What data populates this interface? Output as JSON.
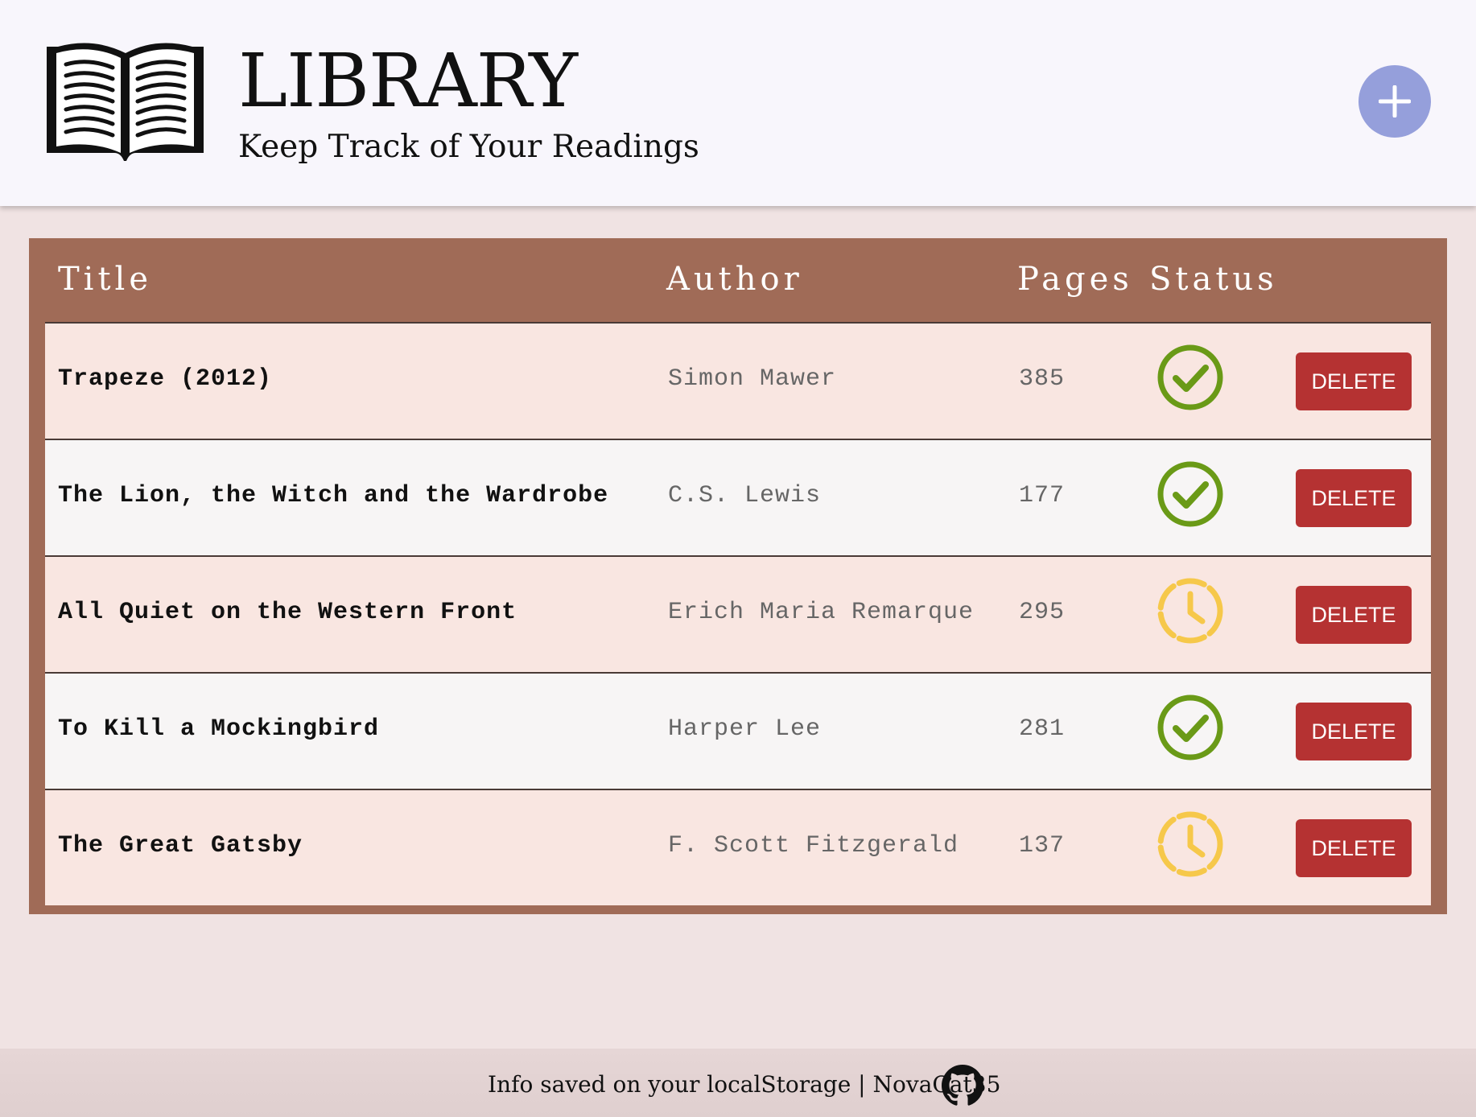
{
  "header": {
    "title": "LIBRARY",
    "subtitle": "Keep Track of Your Readings",
    "logo_icon": "open-book-icon",
    "add_icon": "plus-icon",
    "add_button_color": "#959fdb"
  },
  "table": {
    "columns": [
      "Title",
      "Author",
      "Pages",
      "Status"
    ],
    "header_color": "#a06b57",
    "rows": [
      {
        "title": "Trapeze (2012)",
        "author": "Simon Mawer",
        "pages": "385",
        "status": "read",
        "delete_label": "DELETE"
      },
      {
        "title": "The Lion, the Witch and the Wardrobe",
        "author": "C.S. Lewis",
        "pages": "177",
        "status": "read",
        "delete_label": "DELETE"
      },
      {
        "title": "All Quiet on the Western Front",
        "author": "Erich Maria Remarque",
        "pages": "295",
        "status": "pending",
        "delete_label": "DELETE"
      },
      {
        "title": "To Kill a Mockingbird",
        "author": "Harper Lee",
        "pages": "281",
        "status": "read",
        "delete_label": "DELETE"
      },
      {
        "title": "The Great Gatsby",
        "author": "F. Scott Fitzgerald",
        "pages": "137",
        "status": "pending",
        "delete_label": "DELETE"
      }
    ],
    "status_icons": {
      "read": "check-circle-icon",
      "pending": "clock-icon"
    },
    "status_colors": {
      "read": "#6a9a17",
      "pending": "#f6c84a"
    },
    "delete_color": "#b53232"
  },
  "footer": {
    "text": "Info saved on your localStorage | NovaCat35",
    "icon": "github-icon"
  }
}
